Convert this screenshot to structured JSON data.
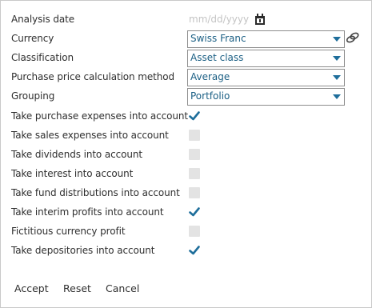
{
  "form": {
    "analysis_date": {
      "label": "Analysis date",
      "value": "",
      "placeholder": "mm/dd/yyyy"
    },
    "currency": {
      "label": "Currency",
      "value": "Swiss Franc"
    },
    "classification": {
      "label": "Classification",
      "value": "Asset class"
    },
    "purchase_method": {
      "label": "Purchase price calculation method",
      "value": "Average"
    },
    "grouping": {
      "label": "Grouping",
      "value": "Portfolio"
    },
    "checkboxes": [
      {
        "label": "Take purchase expenses into account",
        "checked": true
      },
      {
        "label": "Take sales expenses into account",
        "checked": false
      },
      {
        "label": "Take dividends into account",
        "checked": false
      },
      {
        "label": "Take interest into account",
        "checked": false
      },
      {
        "label": "Take fund distributions into account",
        "checked": false
      },
      {
        "label": "Take interim profits into account",
        "checked": true
      },
      {
        "label": "Fictitious currency profit",
        "checked": false
      },
      {
        "label": "Take depositories into account",
        "checked": true
      }
    ]
  },
  "footer": {
    "accept_label": "Accept",
    "reset_label": "Reset",
    "cancel_label": "Cancel"
  },
  "icons": {
    "calendar": "calendar-icon",
    "link": "link-icon",
    "dropdown": "chevron-down-icon",
    "check": "checkmark-icon"
  },
  "colors": {
    "value_text": "#1b5f84",
    "arrow": "#1e6e9b",
    "check": "#1e6e9b",
    "unchecked_box": "#e3e3e3"
  }
}
